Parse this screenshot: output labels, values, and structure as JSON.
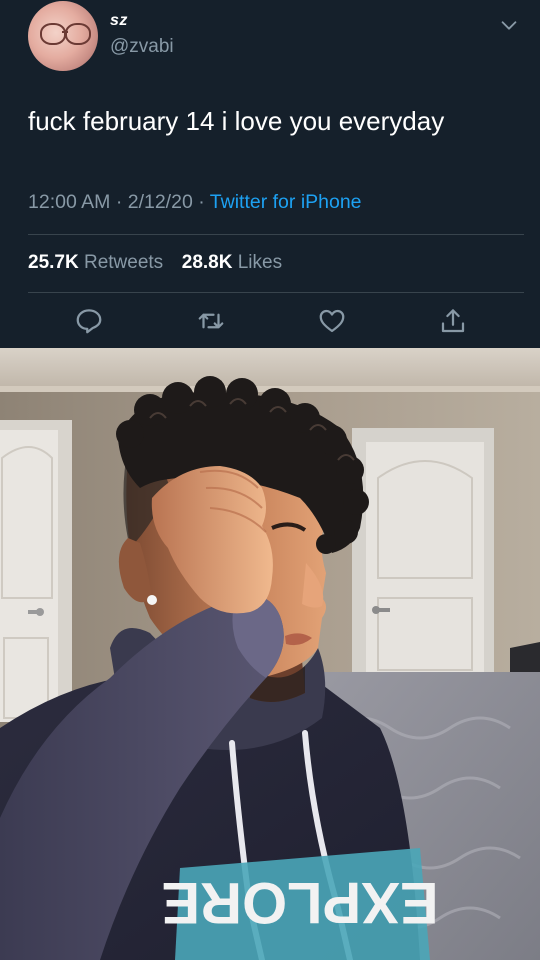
{
  "tweet": {
    "display_name": "sz",
    "handle": "@zvabi",
    "text": "fuck february 14 i love you everyday",
    "time": "12:00 AM",
    "date": "2/12/20",
    "separator": "·",
    "source": "Twitter for iPhone",
    "retweets_count": "25.7K",
    "retweets_label": "Retweets",
    "likes_count": "28.8K",
    "likes_label": "Likes"
  },
  "icons": {
    "menu": "chevron-down-icon",
    "reply": "reply-icon",
    "retweet": "retweet-icon",
    "like": "heart-icon",
    "share": "share-icon"
  },
  "colors": {
    "background": "#15202b",
    "secondary_text": "#8899a6",
    "link": "#1da1f2",
    "divider": "#38444d"
  },
  "photo": {
    "shirt_text": "EXPLORE"
  }
}
